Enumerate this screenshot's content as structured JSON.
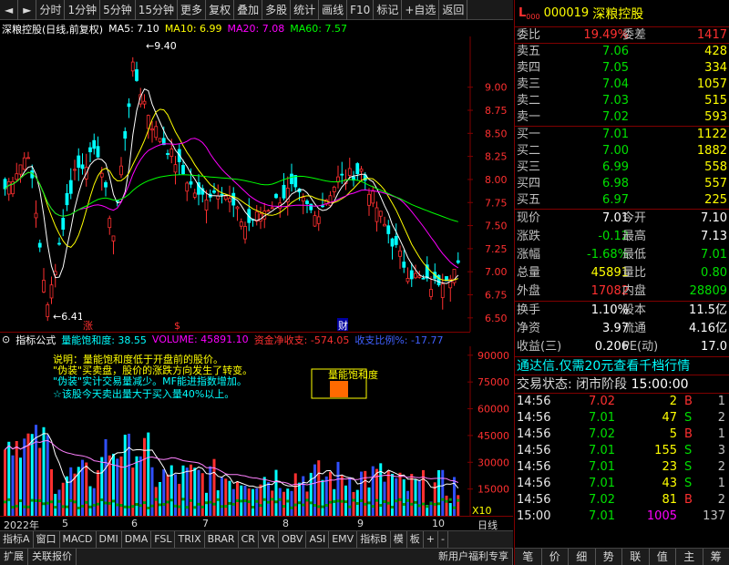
{
  "toolbar": {
    "items": [
      "分时",
      "1分钟",
      "5分钟",
      "15分钟",
      "更多",
      "复权",
      "叠加",
      "多股",
      "统计",
      "画线",
      "F10",
      "标记",
      "+自选",
      "返回"
    ]
  },
  "chart": {
    "title": "深粮控股(日线,前复权)",
    "ma5": "MA5: 7.10",
    "ma10": "MA10: 6.99",
    "ma20": "MA20: 7.08",
    "ma60": "MA60: 7.57",
    "high_marker": "9.40",
    "low_marker": "6.41",
    "price_ticks": [
      "9.00",
      "8.75",
      "8.50",
      "8.25",
      "8.00",
      "7.75",
      "7.50",
      "7.25",
      "7.00",
      "6.75",
      "6.50"
    ],
    "event_marks": [
      "涨",
      "$",
      "财"
    ]
  },
  "indicator": {
    "name": "指标公式",
    "lnbhd": "量能饱和度: 38.55",
    "volume": "VOLUME: 45891.10",
    "capital": "资金净收支: -574.05",
    "buy_sell": "收支比例%: -17.77",
    "notes": [
      "说明：量能饱和度低于开盘前的股价。",
      "\"伪装\"买卖盘，股价的涨跌方向发生了转变。",
      "\"伪装\"实计交易量减少。MF能进指数增加。",
      "☆该股今天卖出量大于买入量40%以上。"
    ],
    "box_label": "量能饱和度",
    "vol_ticks": [
      "90000",
      "75000",
      "60000",
      "45000",
      "30000",
      "15000"
    ],
    "scale": "X10"
  },
  "date_axis": {
    "labels": [
      "2022年",
      "5",
      "6",
      "7",
      "8",
      "9",
      "10"
    ],
    "period": "日线"
  },
  "indicator_tabs": [
    "指标A",
    "窗口",
    "MACD",
    "DMI",
    "DMA",
    "FSL",
    "TRIX",
    "BRAR",
    "CR",
    "VR",
    "OBV",
    "ASI",
    "EMV",
    "指标B",
    "模",
    "板",
    "+",
    "-"
  ],
  "bottom_bar": {
    "left": [
      "扩展",
      "关联报价"
    ],
    "right": "新用户福利专享"
  },
  "stock": {
    "flag": "L",
    "flag_sub": "000",
    "code": "000019",
    "name": "深粮控股"
  },
  "order_book": {
    "ratio_label": "委比",
    "ratio": "19.49%",
    "diff_label": "委差",
    "diff": "1417",
    "asks": [
      {
        "label": "卖五",
        "price": "7.06",
        "vol": "428"
      },
      {
        "label": "卖四",
        "price": "7.05",
        "vol": "334"
      },
      {
        "label": "卖三",
        "price": "7.04",
        "vol": "1057"
      },
      {
        "label": "卖二",
        "price": "7.03",
        "vol": "515"
      },
      {
        "label": "卖一",
        "price": "7.02",
        "vol": "593"
      }
    ],
    "bids": [
      {
        "label": "买一",
        "price": "7.01",
        "vol": "1122"
      },
      {
        "label": "买二",
        "price": "7.00",
        "vol": "1882"
      },
      {
        "label": "买三",
        "price": "6.99",
        "vol": "558"
      },
      {
        "label": "买四",
        "price": "6.98",
        "vol": "557"
      },
      {
        "label": "买五",
        "price": "6.97",
        "vol": "225"
      }
    ]
  },
  "quote": {
    "rows": [
      {
        "l1": "现价",
        "v1": "7.01",
        "c1": "#ffffff",
        "l2": "今开",
        "v2": "7.10",
        "c2": "#ffffff"
      },
      {
        "l1": "涨跌",
        "v1": "-0.12",
        "c1": "#00e000",
        "l2": "最高",
        "v2": "7.13",
        "c2": "#ffffff"
      },
      {
        "l1": "涨幅",
        "v1": "-1.68%",
        "c1": "#00e000",
        "l2": "最低",
        "v2": "7.01",
        "c2": "#00e000"
      },
      {
        "l1": "总量",
        "v1": "45891",
        "c1": "#ffff00",
        "l2": "量比",
        "v2": "0.80",
        "c2": "#00e000"
      },
      {
        "l1": "外盘",
        "v1": "17082",
        "c1": "#ff3030",
        "l2": "内盘",
        "v2": "28809",
        "c2": "#00e000"
      }
    ],
    "rows2": [
      {
        "l1": "换手",
        "v1": "1.10%",
        "c1": "#ffffff",
        "l2": "股本",
        "v2": "11.5亿",
        "c2": "#ffffff"
      },
      {
        "l1": "净资",
        "v1": "3.97",
        "c1": "#ffffff",
        "l2": "流通",
        "v2": "4.16亿",
        "c2": "#ffffff"
      },
      {
        "l1": "收益(三)",
        "v1": "0.206",
        "c1": "#ffffff",
        "l2": "PE(动)",
        "v2": "17.0",
        "c2": "#ffffff"
      }
    ]
  },
  "ad": "通达信.仅需20元查看千档行情",
  "trade_state": {
    "label": "交易状态: 闭市阶段",
    "time": "15:00:00"
  },
  "trades": [
    {
      "t": "14:56",
      "p": "7.02",
      "pc": "#ff3030",
      "v": "2",
      "vc": "#ffff00",
      "f": "B",
      "fc": "#ff3030",
      "n": "1"
    },
    {
      "t": "14:56",
      "p": "7.01",
      "pc": "#00e000",
      "v": "47",
      "vc": "#ffff00",
      "f": "S",
      "fc": "#00e000",
      "n": "2"
    },
    {
      "t": "14:56",
      "p": "7.02",
      "pc": "#00e000",
      "v": "5",
      "vc": "#ffff00",
      "f": "B",
      "fc": "#ff3030",
      "n": "1"
    },
    {
      "t": "14:56",
      "p": "7.01",
      "pc": "#00e000",
      "v": "155",
      "vc": "#ffff00",
      "f": "S",
      "fc": "#00e000",
      "n": "3"
    },
    {
      "t": "14:56",
      "p": "7.01",
      "pc": "#00e000",
      "v": "23",
      "vc": "#ffff00",
      "f": "S",
      "fc": "#00e000",
      "n": "2"
    },
    {
      "t": "14:56",
      "p": "7.01",
      "pc": "#00e000",
      "v": "43",
      "vc": "#ffff00",
      "f": "S",
      "fc": "#00e000",
      "n": "1"
    },
    {
      "t": "14:56",
      "p": "7.02",
      "pc": "#00e000",
      "v": "81",
      "vc": "#ffff00",
      "f": "B",
      "fc": "#ff3030",
      "n": "2"
    },
    {
      "t": "15:00",
      "p": "7.01",
      "pc": "#00e000",
      "v": "1005",
      "vc": "#ff00ff",
      "f": "",
      "fc": "#ffffff",
      "n": "137"
    }
  ],
  "right_tabs": [
    "笔",
    "价",
    "细",
    "势",
    "联",
    "值",
    "主",
    "筹"
  ],
  "chart_data": {
    "type": "candlestick",
    "price_range": [
      6.41,
      9.4
    ],
    "volume_max": 90000
  }
}
